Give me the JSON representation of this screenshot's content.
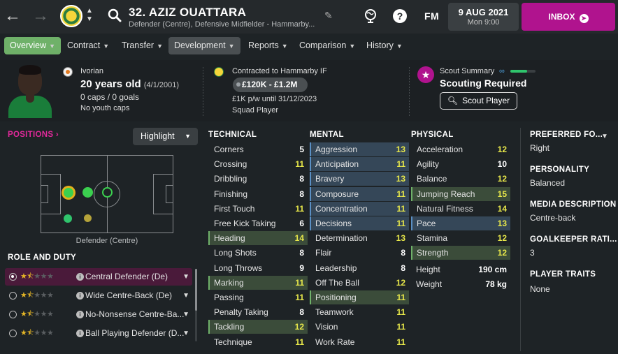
{
  "topbar": {
    "back_icon": "arrow-left-icon",
    "forward_icon": "arrow-right-icon",
    "player_title": "32. AZIZ OUATTARA",
    "player_subtitle": "Defender (Centre), Defensive Midfielder - Hammarby...",
    "fm_label": "FM",
    "date": "9 AUG 2021",
    "day_time": "Mon 9:00",
    "inbox_label": "INBOX",
    "brand_color": "#b0138e"
  },
  "tabs": [
    {
      "label": "Overview"
    },
    {
      "label": "Contract"
    },
    {
      "label": "Transfer"
    },
    {
      "label": "Development"
    },
    {
      "label": "Reports"
    },
    {
      "label": "Comparison"
    },
    {
      "label": "History"
    }
  ],
  "profile": {
    "nationality": "Ivorian",
    "age": "20 years old",
    "dob": "(4/1/2001)",
    "caps": "0 caps / 0 goals",
    "youth_caps": "No youth caps"
  },
  "contract": {
    "club_line": "Contracted to Hammarby IF",
    "value_range": "£120K - £1.2M",
    "wage": "£1K p/w until 31/12/2023",
    "squad_status": "Squad Player"
  },
  "scout": {
    "label": "Scout Summary",
    "status": "Scouting Required",
    "button": "Scout Player",
    "knowledge_fraction": 0.67
  },
  "positions": {
    "title": "POSITIONS ›",
    "highlight_label": "Highlight",
    "position_label": "Defender (Centre)"
  },
  "roles": {
    "title": "ROLE AND DUTY",
    "items": [
      {
        "name": "Central Defender (De)",
        "stars": 1.5,
        "selected": true
      },
      {
        "name": "Wide Centre-Back (De)",
        "stars": 1.5,
        "selected": false
      },
      {
        "name": "No-Nonsense Centre-Ba...",
        "stars": 1.5,
        "selected": false
      },
      {
        "name": "Ball Playing Defender (D...",
        "stars": 1.5,
        "selected": false
      }
    ]
  },
  "technical": {
    "title": "TECHNICAL",
    "items": [
      {
        "name": "Corners",
        "value": "5"
      },
      {
        "name": "Crossing",
        "value": "11"
      },
      {
        "name": "Dribbling",
        "value": "8"
      },
      {
        "name": "Finishing",
        "value": "8"
      },
      {
        "name": "First Touch",
        "value": "11"
      },
      {
        "name": "Free Kick Taking",
        "value": "6"
      },
      {
        "name": "Heading",
        "value": "14"
      },
      {
        "name": "Long Shots",
        "value": "8"
      },
      {
        "name": "Long Throws",
        "value": "9"
      },
      {
        "name": "Marking",
        "value": "11"
      },
      {
        "name": "Passing",
        "value": "11"
      },
      {
        "name": "Penalty Taking",
        "value": "8"
      },
      {
        "name": "Tackling",
        "value": "12"
      },
      {
        "name": "Technique",
        "value": "11"
      }
    ]
  },
  "mental": {
    "title": "MENTAL",
    "items": [
      {
        "name": "Aggression",
        "value": "13"
      },
      {
        "name": "Anticipation",
        "value": "11"
      },
      {
        "name": "Bravery",
        "value": "13"
      },
      {
        "name": "Composure",
        "value": "11"
      },
      {
        "name": "Concentration",
        "value": "11"
      },
      {
        "name": "Decisions",
        "value": "11"
      },
      {
        "name": "Determination",
        "value": "13"
      },
      {
        "name": "Flair",
        "value": "8"
      },
      {
        "name": "Leadership",
        "value": "8"
      },
      {
        "name": "Off The Ball",
        "value": "12"
      },
      {
        "name": "Positioning",
        "value": "11"
      },
      {
        "name": "Teamwork",
        "value": "11"
      },
      {
        "name": "Vision",
        "value": "11"
      },
      {
        "name": "Work Rate",
        "value": "11"
      }
    ]
  },
  "physical": {
    "title": "PHYSICAL",
    "items": [
      {
        "name": "Acceleration",
        "value": "12"
      },
      {
        "name": "Agility",
        "value": "10"
      },
      {
        "name": "Balance",
        "value": "12"
      },
      {
        "name": "Jumping Reach",
        "value": "15"
      },
      {
        "name": "Natural Fitness",
        "value": "14"
      },
      {
        "name": "Pace",
        "value": "13"
      },
      {
        "name": "Stamina",
        "value": "12"
      },
      {
        "name": "Strength",
        "value": "12"
      }
    ],
    "height_label": "Height",
    "height_value": "190 cm",
    "weight_label": "Weight",
    "weight_value": "78 kg"
  },
  "right_panel": {
    "preferred_foot_title": "PREFERRED FO...",
    "preferred_foot_value": "Right",
    "personality_title": "PERSONALITY",
    "personality_value": "Balanced",
    "media_title": "MEDIA DESCRIPTION",
    "media_value": "Centre-back",
    "gk_title": "GOALKEEPER RATI...",
    "gk_value": "3",
    "traits_title": "PLAYER TRAITS",
    "traits_value": "None"
  }
}
